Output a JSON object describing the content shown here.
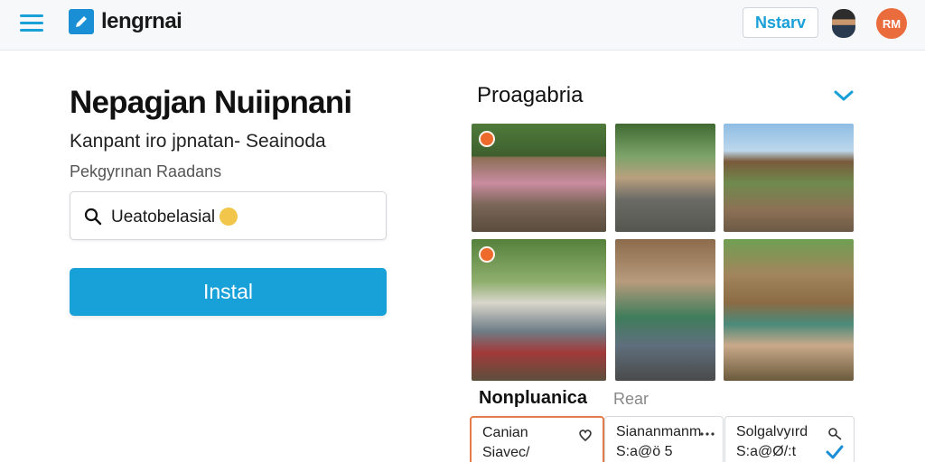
{
  "header": {
    "app_name": "lengrnai",
    "nav_button_label": "Nstarv",
    "user_initials": "RM"
  },
  "main": {
    "title": "Nepagjan Nuiipnani",
    "subtitle": "Kanpant iro jpnatan- Seainoda",
    "field_label": "Pekgyrınan Raadans",
    "search": {
      "value": "Ueatobelasial"
    },
    "primary_button_label": "Instal"
  },
  "gallery": {
    "title": "Proagabria",
    "photos": [
      {
        "name": "photo-people-group",
        "badge": true
      },
      {
        "name": "photo-village-street",
        "badge": false
      },
      {
        "name": "photo-motorbikes",
        "badge": false
      },
      {
        "name": "photo-crowd-road",
        "badge": true
      },
      {
        "name": "photo-shop-vendor",
        "badge": false
      },
      {
        "name": "photo-thatched-hut",
        "badge": false
      }
    ],
    "tabs": [
      {
        "label": "Nonpluanica",
        "active": true
      },
      {
        "label": "Rear",
        "active": false
      }
    ],
    "cards": [
      {
        "title": "Canian",
        "sub": "Siavec/",
        "icon": "heart-icon",
        "selected": true
      },
      {
        "title": "Siananmanm",
        "sub": "S:a@ö 5",
        "icon": "ellipsis-icon",
        "selected": false
      },
      {
        "title": "Solgalvyırd",
        "sub": "S:a@Ø/:t",
        "icon": "key-icon",
        "selected": false
      }
    ]
  },
  "colors": {
    "accent": "#18a0d8",
    "brand_icon": "#1a8fd6",
    "avatar": "#ea6b3c",
    "selected_border": "#e47b4b",
    "badge": "#ee6a2c"
  }
}
